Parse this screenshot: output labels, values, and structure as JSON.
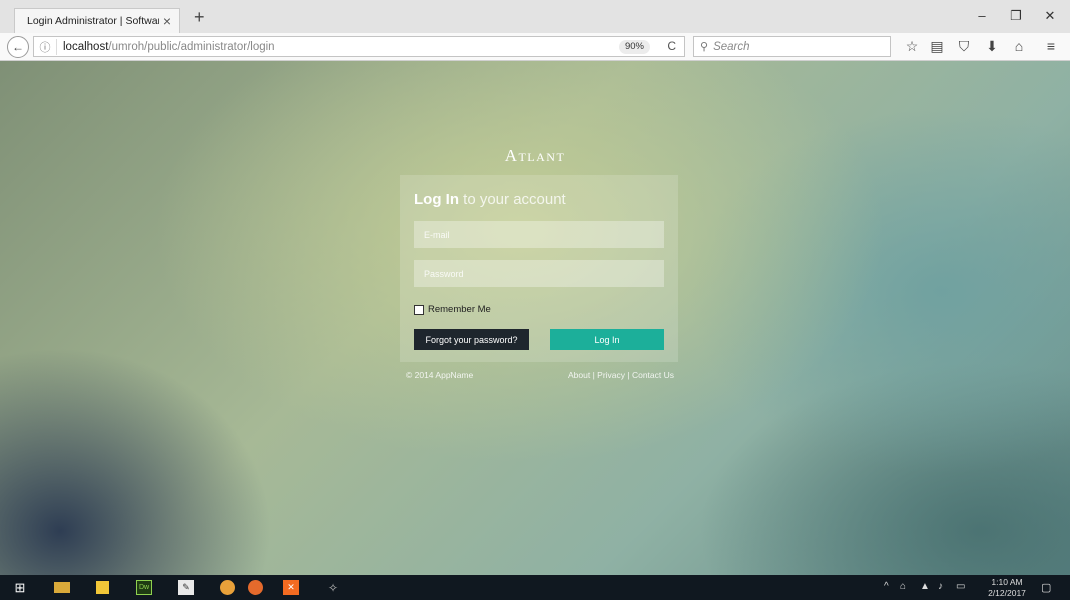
{
  "browser": {
    "tab_title": "Login Administrator | Software...",
    "url_host": "localhost",
    "url_path": "/umroh/public/administrator/login",
    "zoom": "90%",
    "search_placeholder": "Search"
  },
  "page": {
    "brand": "Atlant",
    "heading_bold": "Log In",
    "heading_rest": " to your account",
    "email_placeholder": "E-mail",
    "password_placeholder": "Password",
    "remember_label": "Remember Me",
    "forgot_label": "Forgot your password?",
    "login_label": "Log In",
    "copyright": "© 2014 AppName",
    "links": [
      "About",
      "Privacy",
      "Contact Us"
    ],
    "link_separator": " | "
  },
  "colors": {
    "accent": "#1caf9a",
    "dark_button": "#1e262d"
  },
  "taskbar": {
    "time": "1:10 AM",
    "date": "2/12/2017",
    "apps": [
      "windows-start-icon",
      "file-explorer-icon",
      "sticky-notes-icon",
      "dreamweaver-icon",
      "edit-icon",
      "chrome-icon",
      "firefox-icon",
      "xampp-icon",
      "tool-icon"
    ]
  }
}
